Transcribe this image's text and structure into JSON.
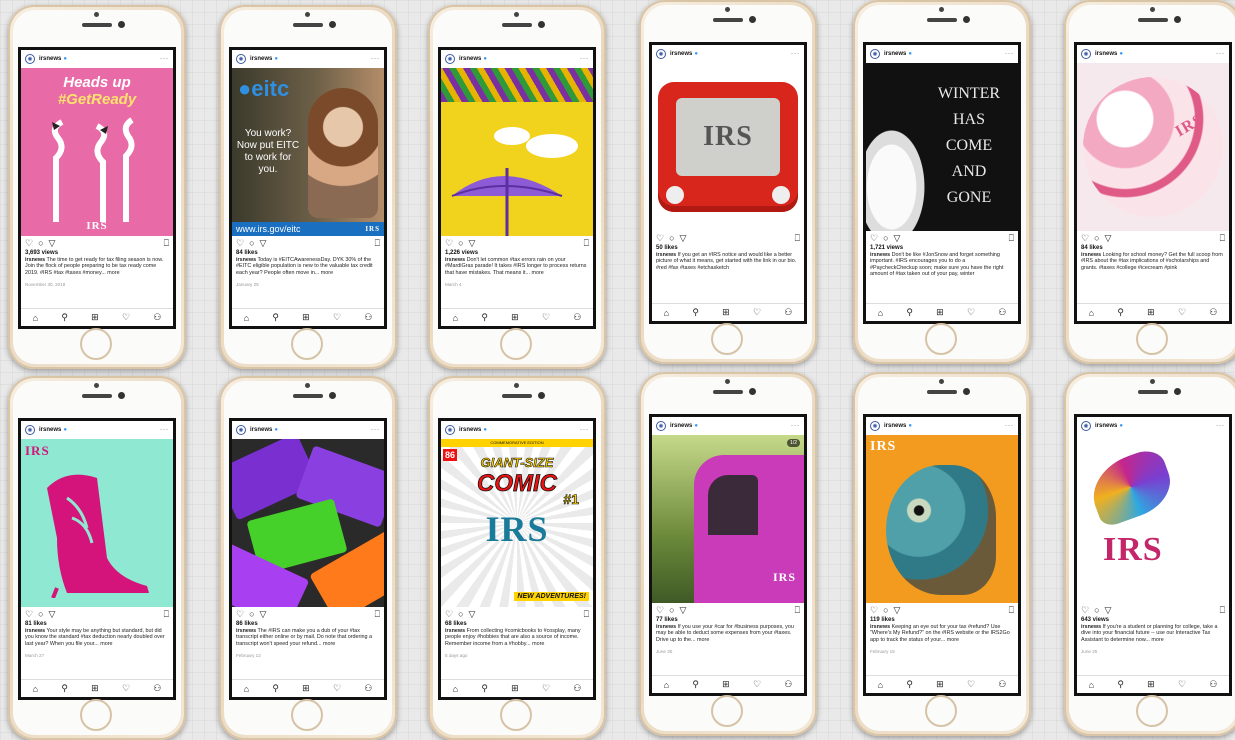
{
  "account": {
    "name": "irsnews",
    "verified_icon": "verified-badge-icon",
    "more": "···"
  },
  "nav_icons": [
    "home-icon",
    "search-icon",
    "new-post-icon",
    "heart-icon",
    "profile-icon"
  ],
  "posts": [
    {
      "count": "3,693 views",
      "caption_user": "irsnews",
      "caption": "The time to get ready for tax filing season is now. Join the flock of people preparing to be tax ready come 2019. #IRS #tax #taxes #money... more",
      "date": "November 30, 2018",
      "headline": "Heads up",
      "hashtag": "#GetReady",
      "logo": "IRS",
      "bg": "#e86aa6"
    },
    {
      "count": "84 likes",
      "caption_user": "irsnews",
      "caption": "Today is #EITCAwarenessDay. DYK 30% of the #EITC eligible population is new to the valuable tax credit each year? People often move in... more",
      "date": "January 25",
      "brand": "eitc",
      "headline": "You work? Now put EITC to work for you.",
      "url": "www.irs.gov/eitc",
      "logo": "IRS",
      "bg": "#4a5a3c"
    },
    {
      "count": "1,226 views",
      "caption_user": "irsnews",
      "caption": "Don't let common #tax errors rain on your #MardiGras parade! It takes #IRS longer to process returns that have mistakes. That means it... more",
      "date": "March 4",
      "bg": "#f1d21c"
    },
    {
      "count": "50 likes",
      "caption_user": "irsnews",
      "caption": "If you get an #IRS notice and would like a better picture of what it means, get started with the link in our bio. #red #fax #taxes #etchasketch",
      "date": "",
      "logo": "IRS",
      "bg": "#ffffff"
    },
    {
      "count": "1,721 views",
      "caption_user": "irsnews",
      "caption": "Don't be like #JonSnow and forget something important. #IRS encourages you to do a #PaycheckCheckup soon; make sure you have the right amount of #tax taken out of your pay, winter",
      "date": "",
      "lines": [
        "WINTER",
        "HAS",
        "COME",
        "AND",
        "GONE"
      ],
      "bg": "#111111"
    },
    {
      "count": "84 likes",
      "caption_user": "irsnews",
      "caption": "Looking for school money? Get the full scoop from #IRS about the #tax implications of #scholarships and grants. #taxes #college #icecream #pink",
      "date": "",
      "logo": "IRS",
      "bg": "#f6e9ee"
    },
    {
      "count": "81 likes",
      "caption_user": "irsnews",
      "caption": "Your style may be anything but standard, but did you know the standard #tax deduction nearly doubled over last year? When you file your... more",
      "date": "March 27",
      "logo": "IRS",
      "bg": "#8fe8d2"
    },
    {
      "count": "86 likes",
      "caption_user": "irsnews",
      "caption": "The #IRS can make you a dub of your #tax transcript either online or by mail. Do note that ordering a transcript won't speed your refund... more",
      "date": "February 12",
      "bg": "#2a2a2a"
    },
    {
      "count": "68 likes",
      "caption_user": "irsnews",
      "caption": "From collecting #comicbooks to #cosplay, many people enjoy #hobbies that are also a source of income. Remember income from a #hobby... more",
      "date": "5 days ago",
      "issue": "86",
      "banner": "COMMEMORATIVE EDITION",
      "title1": "GIANT-SIZE",
      "title2": "COMIC",
      "badge": "#1",
      "logo": "IRS",
      "tagline": "NEW ADVENTURES!",
      "bg": "#ffffff"
    },
    {
      "count": "77 likes",
      "caption_user": "irsnews",
      "caption": "If you use your #car for #business purposes, you may be able to deduct some expenses from your #taxes. Drive up to the... more",
      "date": "June 30",
      "logo": "IRS",
      "pager": "1/2",
      "bg": "#6c8a3a"
    },
    {
      "count": "119 likes",
      "caption_user": "irsnews",
      "caption": "Keeping an eye out for your tax #refund? Use \"Where's My Refund?\" on the #IRS website or the IRS2Go app to track the status of your... more",
      "date": "February 15",
      "logo": "IRS",
      "bg": "#f39b1f"
    },
    {
      "count": "643 views",
      "caption_user": "irsnews",
      "caption": "If you're a student or planning for college, take a dive into your financial future -- use our Interactive Tax Assistant to determine now... more",
      "date": "June 25",
      "logo": "IRS",
      "bg": "#ffffff"
    }
  ]
}
